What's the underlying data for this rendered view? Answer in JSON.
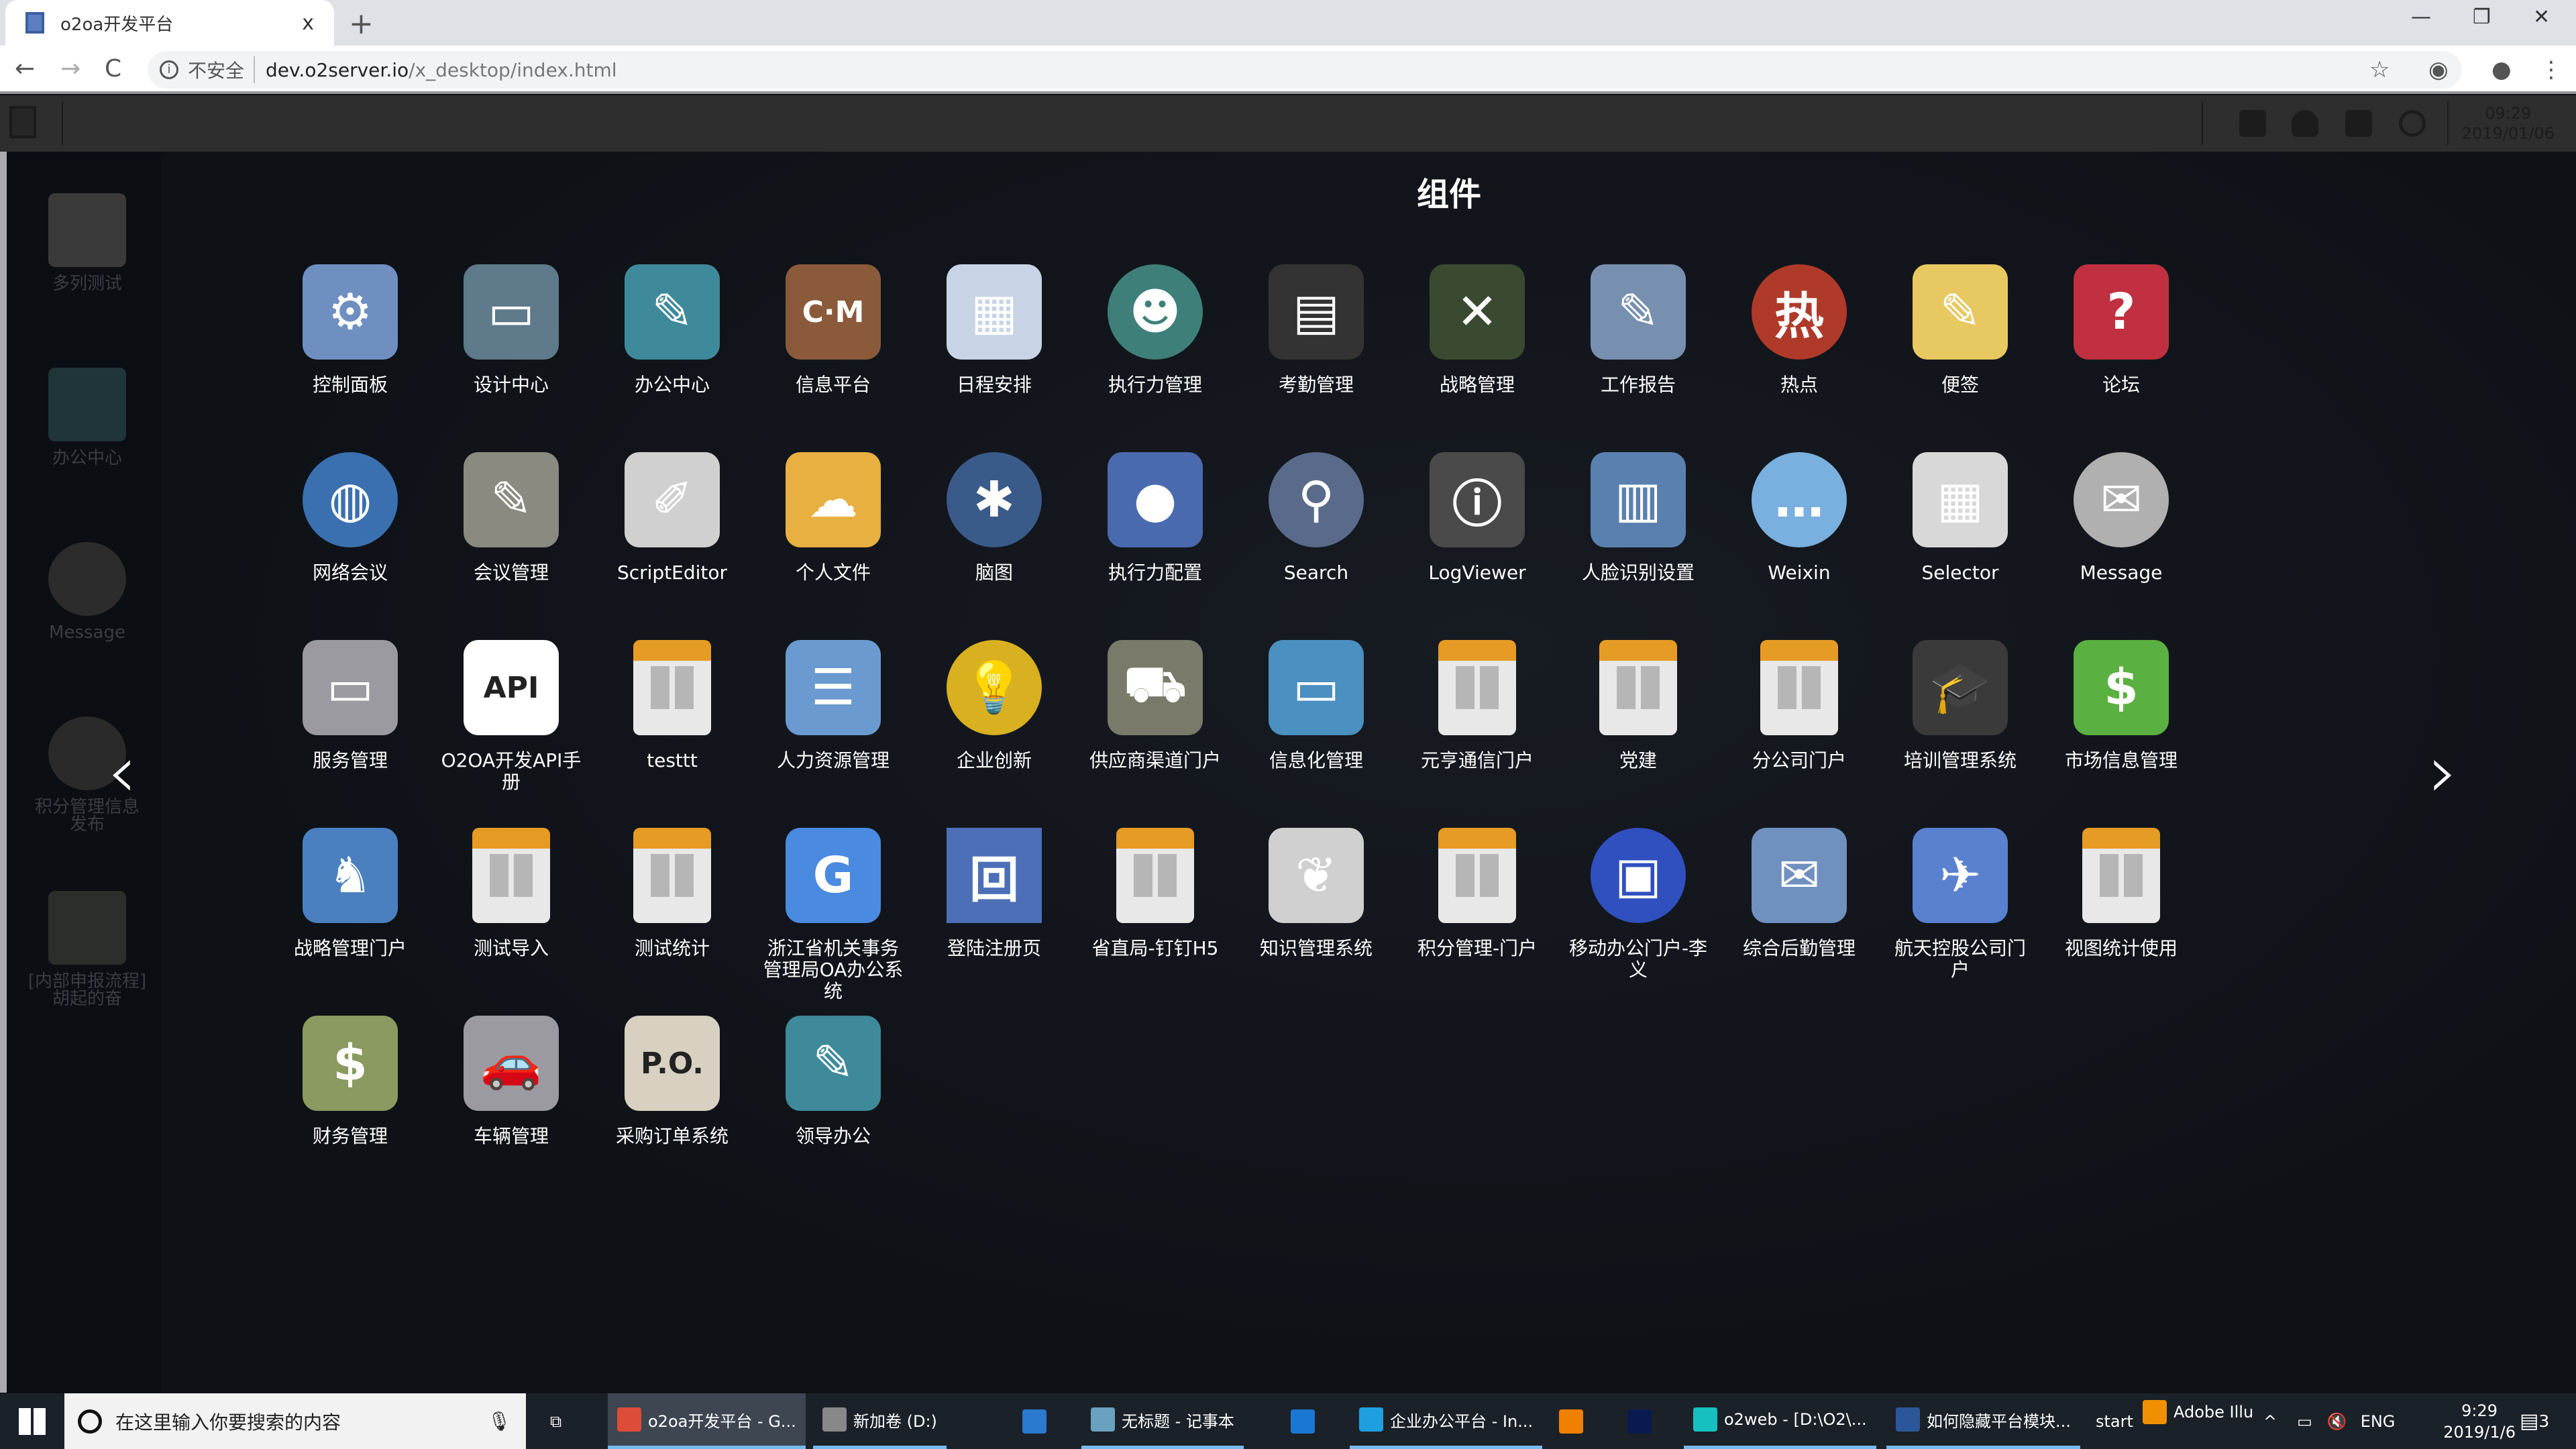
{
  "browser": {
    "tab_title": "o2oa开发平台",
    "tab_close": "x",
    "new_tab": "+",
    "not_secure": "不安全",
    "url_host": "dev.o2server.io",
    "url_path": "/x_desktop/index.html",
    "back": "←",
    "forward": "→",
    "reload": "C",
    "minimize": "—",
    "restore": "❐",
    "close": "✕",
    "star": "☆",
    "menu": "⋮"
  },
  "topbar": {
    "time": "09:29",
    "date": "2019/01/06",
    "icons": [
      "chat-icon",
      "user-icon",
      "skin-icon",
      "power-icon"
    ]
  },
  "sidebar": {
    "items": [
      {
        "label": "多列测试",
        "icon": "chart-icon",
        "color": "#3a3a3a"
      },
      {
        "label": "办公中心",
        "icon": "notebook-icon",
        "color": "#1f3538"
      },
      {
        "label": "Message",
        "icon": "mail-icon",
        "color": "#2c2c2c"
      },
      {
        "label": "积分管理信息发布",
        "icon": "o2-logo-icon",
        "color": "#2a2a2a"
      },
      {
        "label": "[内部申报流程]胡起的奋",
        "icon": "default-app-icon",
        "color": "#2b2e2b"
      }
    ]
  },
  "main": {
    "title": "组件",
    "prev": "‹",
    "next": "›",
    "apps": [
      {
        "label": "控制面板",
        "icon": "control-panel-icon",
        "glyph": "⚙",
        "color": "#6f8fc0"
      },
      {
        "label": "设计中心",
        "icon": "monitor-icon",
        "glyph": "▭",
        "color": "#5f7a8a"
      },
      {
        "label": "办公中心",
        "icon": "notebook-icon",
        "glyph": "✎",
        "color": "#3f8a9a"
      },
      {
        "label": "信息平台",
        "icon": "book-icon",
        "glyph": "C·M",
        "color": "#8a5a3a"
      },
      {
        "label": "日程安排",
        "icon": "calendar-icon",
        "glyph": "▦",
        "color": "#c8d4e6"
      },
      {
        "label": "执行力管理",
        "icon": "manager-icon",
        "glyph": "☻",
        "color": "#3f7f7a",
        "shape": "circle"
      },
      {
        "label": "考勤管理",
        "icon": "attendance-icon",
        "glyph": "▤",
        "color": "#333333"
      },
      {
        "label": "战略管理",
        "icon": "chalkboard-icon",
        "glyph": "✕",
        "color": "#3a4a30"
      },
      {
        "label": "工作报告",
        "icon": "clipboard-icon",
        "glyph": "✎",
        "color": "#7890b0"
      },
      {
        "label": "热点",
        "icon": "hotspot-icon",
        "glyph": "热",
        "color": "#b03a2a",
        "shape": "circle"
      },
      {
        "label": "便签",
        "icon": "note-icon",
        "glyph": "✎",
        "color": "#e8c860"
      },
      {
        "label": "论坛",
        "icon": "forum-icon",
        "glyph": "?",
        "color": "#c03040"
      },
      {
        "label": "网络会议",
        "icon": "globe-icon",
        "glyph": "◍",
        "color": "#3a70b0",
        "shape": "circle"
      },
      {
        "label": "会议管理",
        "icon": "meeting-icon",
        "glyph": "✎",
        "color": "#8a8a80"
      },
      {
        "label": "ScriptEditor",
        "icon": "scroll-icon",
        "glyph": "✐",
        "color": "#d0d0d0"
      },
      {
        "label": "个人文件",
        "icon": "folder-icon",
        "glyph": "☁",
        "color": "#e8b040"
      },
      {
        "label": "脑图",
        "icon": "mindmap-icon",
        "glyph": "✱",
        "color": "#3a5a8a",
        "shape": "circle"
      },
      {
        "label": "执行力配置",
        "icon": "team-icon",
        "glyph": "●",
        "color": "#4a6ab0"
      },
      {
        "label": "Search",
        "icon": "magnifier-icon",
        "glyph": "⚲",
        "color": "#5a6a8a",
        "shape": "circle"
      },
      {
        "label": "LogViewer",
        "icon": "log-icon",
        "glyph": "ⓘ",
        "color": "#4a4a4a"
      },
      {
        "label": "人脸识别设置",
        "icon": "building-icon",
        "glyph": "▥",
        "color": "#5a80b0"
      },
      {
        "label": "Weixin",
        "icon": "wechat-icon",
        "glyph": "…",
        "color": "#7ab0e0",
        "shape": "circle"
      },
      {
        "label": "Selector",
        "icon": "table-icon",
        "glyph": "▦",
        "color": "#d8d8d8"
      },
      {
        "label": "Message",
        "icon": "mail-icon",
        "glyph": "✉",
        "color": "#b0b0b0",
        "shape": "circle"
      },
      {
        "label": "服务管理",
        "icon": "imac-icon",
        "glyph": "▭",
        "color": "#9a9aa0"
      },
      {
        "label": "O2OA开发API手册",
        "icon": "api-icon",
        "glyph": "API",
        "color": "#ffffff",
        "dark": true
      },
      {
        "label": "testtt",
        "icon": "default-app-icon",
        "placeholder": true
      },
      {
        "label": "人力资源管理",
        "icon": "id-card-icon",
        "glyph": "☰",
        "color": "#6a9ad0"
      },
      {
        "label": "企业创新",
        "icon": "lightbulb-icon",
        "glyph": "💡",
        "color": "#d8b020",
        "shape": "circle"
      },
      {
        "label": "供应商渠道门户",
        "icon": "truck-icon",
        "glyph": "⛟",
        "color": "#7a7a6a"
      },
      {
        "label": "信息化管理",
        "icon": "computers-icon",
        "glyph": "▭",
        "color": "#4a90c0"
      },
      {
        "label": "元亨通信门户",
        "icon": "default-app-icon",
        "placeholder": true
      },
      {
        "label": "党建",
        "icon": "default-app-icon",
        "placeholder": true
      },
      {
        "label": "分公司门户",
        "icon": "default-app-icon",
        "placeholder": true
      },
      {
        "label": "培训管理系统",
        "icon": "graduation-cap-icon",
        "glyph": "🎓",
        "color": "#3a3a3a"
      },
      {
        "label": "市场信息管理",
        "icon": "money-icon",
        "glyph": "$",
        "color": "#5ab040"
      },
      {
        "label": "战略管理门户",
        "icon": "chess-icon",
        "glyph": "♞",
        "color": "#4a80c0"
      },
      {
        "label": "测试导入",
        "icon": "default-app-icon",
        "placeholder": true
      },
      {
        "label": "测试统计",
        "icon": "default-app-icon",
        "placeholder": true
      },
      {
        "label": "浙江省机关事务管理局OA办公系统",
        "icon": "zj-logo-icon",
        "glyph": "G",
        "color": "#4a8ae0"
      },
      {
        "label": "登陆注册页",
        "icon": "o2-logo-icon",
        "glyph": "回",
        "color": "#4d6fb8",
        "square": true
      },
      {
        "label": "省直局-钉钉H5",
        "icon": "default-app-icon",
        "placeholder": true
      },
      {
        "label": "知识管理系统",
        "icon": "certificate-icon",
        "glyph": "❦",
        "color": "#d0d0d0"
      },
      {
        "label": "积分管理-门户",
        "icon": "default-app-icon",
        "placeholder": true
      },
      {
        "label": "移动办公门户-李义",
        "icon": "mobile-office-icon",
        "glyph": "▣",
        "color": "#3050c0",
        "shape": "circle"
      },
      {
        "label": "综合后勤管理",
        "icon": "documents-icon",
        "glyph": "✉",
        "color": "#7090c0"
      },
      {
        "label": "航天控股公司门户",
        "icon": "rocket-icon",
        "glyph": "✈",
        "color": "#5a80d0"
      },
      {
        "label": "视图统计使用",
        "icon": "default-app-icon",
        "placeholder": true
      },
      {
        "label": "财务管理",
        "icon": "cash-icon",
        "glyph": "$",
        "color": "#8a9a60"
      },
      {
        "label": "车辆管理",
        "icon": "car-icon",
        "glyph": "🚗",
        "color": "#9a9aa0"
      },
      {
        "label": "采购订单系统",
        "icon": "purchase-order-icon",
        "glyph": "P.O.",
        "color": "#d8d0c0",
        "dark": true
      },
      {
        "label": "领导办公",
        "icon": "notebook-icon",
        "glyph": "✎",
        "color": "#3f8a9a"
      }
    ]
  },
  "taskbar": {
    "search_placeholder": "在这里输入你要搜索的内容",
    "items": [
      {
        "label": "o2oa开发平台 - G...",
        "icon": "chrome-icon",
        "color": "#dd4b39",
        "selected": true,
        "active": true
      },
      {
        "label": "新加卷 (D:)",
        "icon": "drive-icon",
        "color": "#888888",
        "active": true
      },
      {
        "label": "",
        "icon": "app-icon",
        "color": "#2a7ad0"
      },
      {
        "label": "无标题 - 记事本",
        "icon": "notepad-icon",
        "color": "#6aa0c0",
        "active": true
      },
      {
        "label": "",
        "icon": "edge-icon",
        "color": "#1a78d4"
      },
      {
        "label": "企业办公平台 - In...",
        "icon": "ie-icon",
        "color": "#1ea0e0",
        "active": true
      },
      {
        "label": "",
        "icon": "vlc-icon",
        "color": "#f08000"
      },
      {
        "label": "",
        "icon": "photoshop-icon",
        "color": "#0a1a50"
      },
      {
        "label": "o2web - [D:\\O2\\...",
        "icon": "webstorm-icon",
        "color": "#16c0c0",
        "active": true
      },
      {
        "label": "如何隐藏平台模块...",
        "icon": "word-icon",
        "color": "#2b579a",
        "active": true
      },
      {
        "label": "start",
        "icon": ""
      },
      {
        "label": "Adobe Illu",
        "icon": "illustrator-icon",
        "color": "#f09000"
      }
    ],
    "tray": {
      "overflow": "^",
      "lang": "ENG",
      "time": "9:29",
      "date": "2019/1/6",
      "notifications": "3"
    }
  }
}
